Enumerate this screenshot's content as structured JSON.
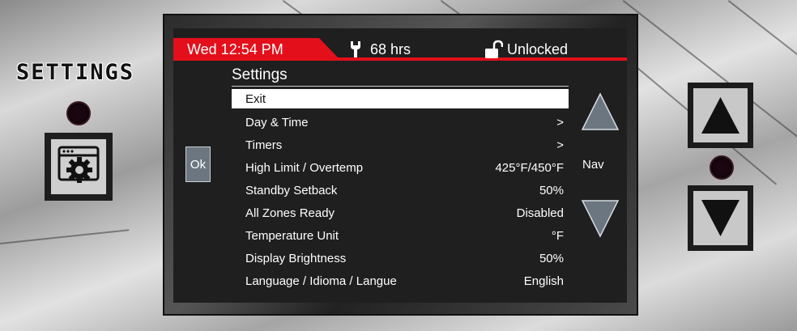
{
  "panel": {
    "settings_label": "SETTINGS"
  },
  "status_bar": {
    "datetime": "Wed 12:54 PM",
    "hours": "68 hrs",
    "lock_state": "Unlocked",
    "accent_color": "#e3101c"
  },
  "menu": {
    "title": "Settings",
    "items": [
      {
        "label": "Exit",
        "value": "",
        "selected": true
      },
      {
        "label": "Day & Time",
        "value": ">"
      },
      {
        "label": "Timers",
        "value": ">"
      },
      {
        "label": "High Limit / Overtemp",
        "value": "425°F/450°F"
      },
      {
        "label": "Standby Setback",
        "value": "50%"
      },
      {
        "label": "All Zones Ready",
        "value": "Disabled"
      },
      {
        "label": "Temperature Unit",
        "value": "°F"
      },
      {
        "label": "Display Brightness",
        "value": "50%"
      },
      {
        "label": "Language / Idioma / Langue",
        "value": "English"
      }
    ]
  },
  "controls": {
    "ok_label": "Ok",
    "nav_label": "Nav"
  },
  "icons": {
    "hours": "wrench-icon",
    "lock": "unlocked-padlock-icon",
    "settings": "settings-gear-window-icon",
    "nav_up": "triangle-up-icon",
    "nav_down": "triangle-down-icon"
  }
}
